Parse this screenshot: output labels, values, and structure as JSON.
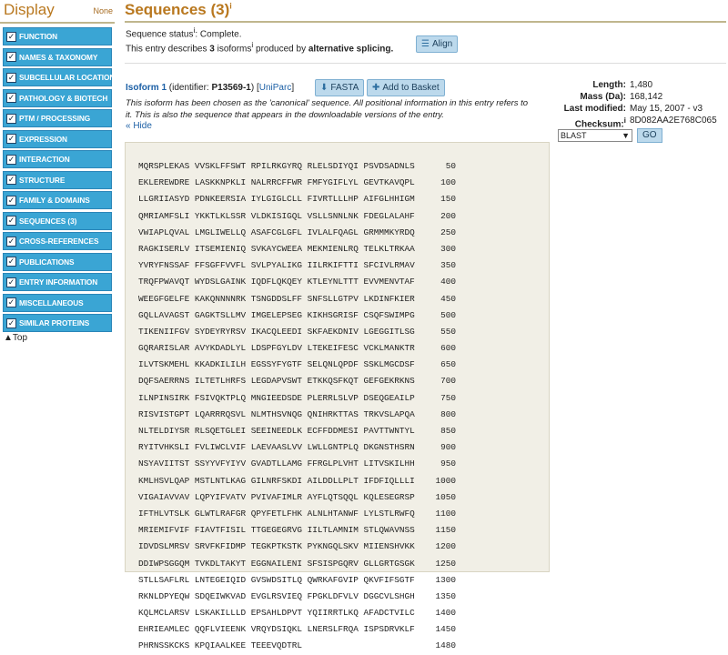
{
  "sidebar": {
    "title": "Display",
    "none_label": "None",
    "items": [
      {
        "label": "FUNCTION"
      },
      {
        "label": "NAMES & TAXONOMY"
      },
      {
        "label": "SUBCELLULAR LOCATION"
      },
      {
        "label": "PATHOLOGY & BIOTECH"
      },
      {
        "label": "PTM / PROCESSING"
      },
      {
        "label": "EXPRESSION"
      },
      {
        "label": "INTERACTION"
      },
      {
        "label": "STRUCTURE"
      },
      {
        "label": "FAMILY & DOMAINS"
      },
      {
        "label": "SEQUENCES (3)"
      },
      {
        "label": "CROSS-REFERENCES"
      },
      {
        "label": "PUBLICATIONS"
      },
      {
        "label": "ENTRY INFORMATION"
      },
      {
        "label": "MISCELLANEOUS"
      },
      {
        "label": "SIMILAR PROTEINS"
      }
    ],
    "top_label": "Top"
  },
  "main": {
    "title": "Sequences (3)",
    "title_sup": "i",
    "status_label": "Sequence status",
    "status_sup": "i",
    "status_value": ": Complete.",
    "desc_pre": "This entry describes ",
    "desc_count": "3",
    "desc_mid": " isoforms",
    "desc_sup": "i",
    "desc_post": " produced by ",
    "desc_bold": "alternative splicing.",
    "align_label": "Align",
    "isoform_name": "Isoform 1",
    "isoform_id_pre": " (identifier: ",
    "isoform_id": "P13569-1",
    "isoform_id_post": ") [",
    "uniparc_label": "UniParc",
    "uniparc_post": "]",
    "fasta_label": "FASTA",
    "basket_label": "Add to Basket",
    "isoform_note": "This isoform has been chosen as the 'canonical' sequence. All positional information in this entry refers to it. This is also the sequence that appears in the downloadable versions of the entry.",
    "hide_label": "« Hide"
  },
  "info": {
    "length_label": "Length:",
    "length_value": "1,480",
    "mass_label": "Mass (Da):",
    "mass_value": "168,142",
    "modified_label": "Last modified:",
    "modified_value": "May 15, 2007 - v3",
    "checksum_label": "Checksum:",
    "checksum_sup": "i",
    "checksum_value": "8D082AA2E768C065",
    "tool_selected": "BLAST",
    "go_label": "GO"
  },
  "sequence": [
    {
      "text": "MQRSPLEKAS VVSKLFFSWT RPILRKGYRQ RLELSDIYQI PSVDSADNLS",
      "num": "50"
    },
    {
      "text": "EKLEREWDRE LASKKNPKLI NALRRCFFWR FMFYGIFLYL GEVTKAVQPL",
      "num": "100"
    },
    {
      "text": "LLGRIIASYD PDNKEERSIA IYLGIGLCLL FIVRTLLLHP AIFGLHHIGM",
      "num": "150"
    },
    {
      "text": "QMRIAMFSLI YKKTLKLSSR VLDKISIGQL VSLLSNNLNK FDEGLALAHF",
      "num": "200"
    },
    {
      "text": "VWIAPLQVAL LMGLIWELLQ ASAFCGLGFL IVLALFQAGL GRMMMKYRDQ",
      "num": "250"
    },
    {
      "text": "RAGKISERLV ITSEMIENIQ SVKAYCWEEA MEKMIENLRQ TELKLTRKAA",
      "num": "300"
    },
    {
      "text": "YVRYFNSSAF FFSGFFVVFL SVLPYALIKG IILRKIFTTI SFCIVLRMAV",
      "num": "350"
    },
    {
      "text": "TRQFPWAVQT WYDSLGAINK IQDFLQKQEY KTLEYNLTTT EVVMENVTAF",
      "num": "400"
    },
    {
      "text": "WEEGFGELFE KAKQNNNNRK TSNGDDSLFF SNFSLLGTPV LKDINFKIER",
      "num": "450"
    },
    {
      "text": "GQLLAVAGST GAGKTSLLMV IMGELEPSEG KIKHSGRISF CSQFSWIMPG",
      "num": "500"
    },
    {
      "text": "TIKENIIFGV SYDEYRYRSV IKACQLEEDI SKFAEKDNIV LGEGGITLSG",
      "num": "550"
    },
    {
      "text": "GQRARISLAR AVYKDADLYL LDSPFGYLDV LTEKEIFESC VCKLMANKTR",
      "num": "600"
    },
    {
      "text": "ILVTSKMEHL KKADKILILH EGSSYFYGTF SELQNLQPDF SSKLMGCDSF",
      "num": "650"
    },
    {
      "text": "DQFSAERRNS ILTETLHRFS LEGDAPVSWT ETKKQSFKQT GEFGEKRKNS",
      "num": "700"
    },
    {
      "text": "ILNPINSIRK FSIVQKTPLQ MNGIEEDSDE PLERRLSLVP DSEQGEAILP",
      "num": "750"
    },
    {
      "text": "RISVISTGPT LQARRRQSVL NLMTHSVNQG QNIHRKTTAS TRKVSLAPQA",
      "num": "800"
    },
    {
      "text": "NLTELDIYSR RLSQETGLEI SEEINEEDLK ECFFDDMESI PAVTTWNTYL",
      "num": "850"
    },
    {
      "text": "RYITVHKSLI FVLIWCLVIF LAEVAASLVV LWLLGNTPLQ DKGNSTHSRN",
      "num": "900"
    },
    {
      "text": "NSYAVIITST SSYYVFYIYV GVADTLLAMG FFRGLPLVHT LITVSKILHH",
      "num": "950"
    },
    {
      "text": "KMLHSVLQAP MSTLNTLKAG GILNRFSKDI AILDDLLPLT IFDFIQLLLI",
      "num": "1000"
    },
    {
      "text": "VIGAIAVVAV LQPYIFVATV PVIVAFIMLR AYFLQTSQQL KQLESEGRSP",
      "num": "1050"
    },
    {
      "text": "IFTHLVTSLK GLWTLRAFGR QPYFETLFHK ALNLHTANWF LYLSTLRWFQ",
      "num": "1100"
    },
    {
      "text": "MRIEMIFVIF FIAVTFISIL TTGEGEGRVG IILTLAMNIM STLQWAVNSS",
      "num": "1150"
    },
    {
      "text": "IDVDSLMRSV SRVFKFIDMP TEGKPTKSTK PYKNGQLSKV MIIENSHVKK",
      "num": "1200"
    },
    {
      "text": "DDIWPSGGQM TVKDLTAKYT EGGNAILENI SFSISPGQRV GLLGRTGSGK",
      "num": "1250"
    },
    {
      "text": "STLLSAFLRL LNTEGEIQID GVSWDSITLQ QWRKAFGVIP QKVFIFSGTF",
      "num": "1300"
    },
    {
      "text": "RKNLDPYEQW SDQEIWKVAD EVGLRSVIEQ FPGKLDFVLV DGGCVLSHGH",
      "num": "1350"
    },
    {
      "text": "KQLMCLARSV LSKAKILLLD EPSAHLDPVT YQIIRRTLKQ AFADCTVILC",
      "num": "1400"
    },
    {
      "text": "EHRIEAMLEC QQFLVIEENK VRQYDSIQKL LNERSLFRQA ISPSDRVKLF",
      "num": "1450"
    },
    {
      "text": "PHRNSSKCKS KPQIAALKEE TEEEVQDTRL",
      "num": "1480"
    }
  ]
}
